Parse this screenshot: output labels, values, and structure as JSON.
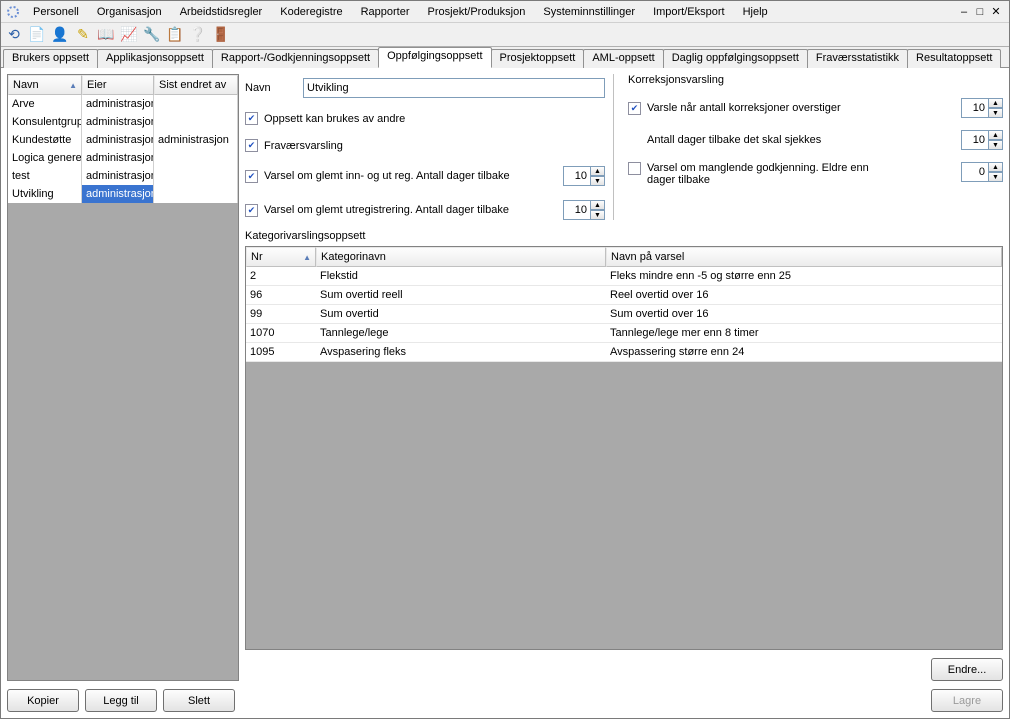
{
  "menu": {
    "items": [
      "Personell",
      "Organisasjon",
      "Arbeidstidsregler",
      "Koderegistre",
      "Rapporter",
      "Prosjekt/Produksjon",
      "Systeminnstillinger",
      "Import/Eksport",
      "Hjelp"
    ]
  },
  "tabs": {
    "items": [
      "Brukers oppsett",
      "Applikasjonsoppsett",
      "Rapport-/Godkjenningsoppsett",
      "Oppfølgingsoppsett",
      "Prosjektoppsett",
      "AML-oppsett",
      "Daglig oppfølgingsoppsett",
      "Fraværsstatistikk",
      "Resultatoppsett"
    ],
    "active": 3
  },
  "left_table": {
    "headers": {
      "navn": "Navn",
      "eier": "Eier",
      "sist": "Sist endret av"
    },
    "rows": [
      {
        "navn": "Arve",
        "eier": "administrasjon",
        "sist": ""
      },
      {
        "navn": "Konsulentgruppe",
        "eier": "administrasjon",
        "sist": ""
      },
      {
        "navn": "Kundestøtte",
        "eier": "administrasjon",
        "sist": "administrasjon"
      },
      {
        "navn": "Logica generell",
        "eier": "administrasjon",
        "sist": ""
      },
      {
        "navn": "test",
        "eier": "administrasjon",
        "sist": ""
      },
      {
        "navn": "Utvikling",
        "eier": "administrasjon",
        "sist": ""
      }
    ],
    "selected": 5
  },
  "left_buttons": {
    "kopier": "Kopier",
    "leggtil": "Legg til",
    "slett": "Slett"
  },
  "form": {
    "navn_label": "Navn",
    "navn_value": "Utvikling",
    "oppsett_label": "Oppsett kan brukes av andre",
    "fravaer_label": "Fraværsvarsling",
    "glemt_innut_label": "Varsel om glemt inn- og ut reg. Antall dager tilbake",
    "glemt_innut_value": "10",
    "glemt_ut_label": "Varsel om glemt utregistrering. Antall dager tilbake",
    "glemt_ut_value": "10",
    "korr_title": "Korreksjonsvarsling",
    "korr_overstiger_label": "Varsle når antall korreksjoner overstiger",
    "korr_overstiger_value": "10",
    "dager_tilbake_label": "Antall dager tilbake det skal sjekkes",
    "dager_tilbake_value": "10",
    "godkj_label": "Varsel om manglende godkjenning. Eldre enn dager tilbake",
    "godkj_value": "0"
  },
  "cat": {
    "label": "Kategorivarslingsoppsett",
    "headers": {
      "nr": "Nr",
      "kat": "Kategorinavn",
      "varsel": "Navn på varsel"
    },
    "rows": [
      {
        "nr": "2",
        "kat": "Flekstid",
        "varsel": "Fleks mindre enn -5 og større enn 25"
      },
      {
        "nr": "96",
        "kat": "Sum overtid reell",
        "varsel": "Reel overtid over 16"
      },
      {
        "nr": "99",
        "kat": "Sum overtid",
        "varsel": "Sum overtid over 16"
      },
      {
        "nr": "1070",
        "kat": "Tannlege/lege",
        "varsel": "Tannlege/lege mer enn 8 timer"
      },
      {
        "nr": "1095",
        "kat": "Avspasering fleks",
        "varsel": "Avspassering større enn 24"
      }
    ]
  },
  "buttons": {
    "endre": "Endre...",
    "lagre": "Lagre"
  }
}
